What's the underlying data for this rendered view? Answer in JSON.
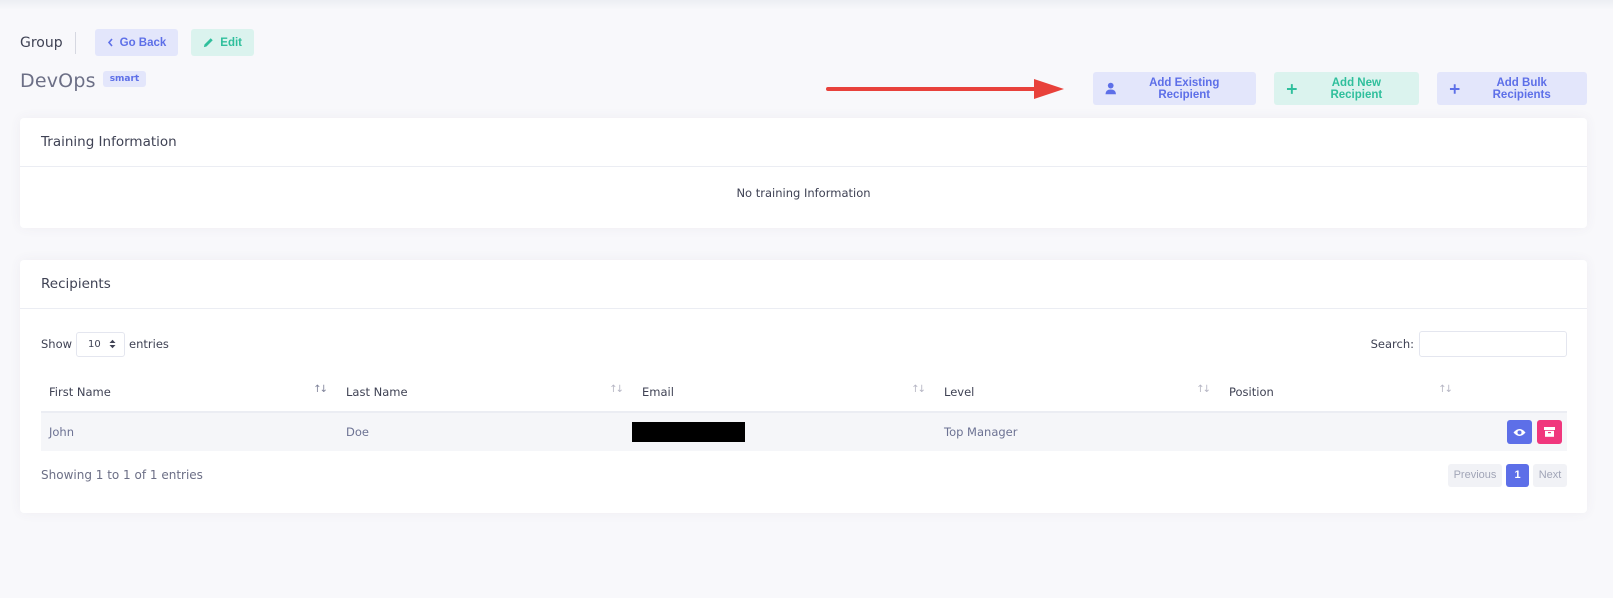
{
  "header": {
    "section_label": "Group",
    "go_back_label": "Go Back",
    "edit_label": "Edit"
  },
  "group": {
    "name": "DevOps",
    "badge": "smart"
  },
  "actions": {
    "add_existing": "Add Existing Recipient",
    "add_new": "Add New Recipient",
    "add_bulk": "Add Bulk Recipients"
  },
  "training": {
    "title": "Training Information",
    "empty_text": "No training Information"
  },
  "recipients": {
    "title": "Recipients",
    "show_label": "Show",
    "entries_label": "entries",
    "page_size": "10",
    "search_label": "Search:",
    "search_value": "",
    "columns": [
      "First Name",
      "Last Name",
      "Email",
      "Level",
      "Position"
    ],
    "rows": [
      {
        "first_name": "John",
        "last_name": "Doe",
        "email": "",
        "level": "Top Manager",
        "position": ""
      }
    ],
    "info": "Showing 1 to 1 of 1 entries",
    "pagination": {
      "previous": "Previous",
      "current": "1",
      "next": "Next"
    }
  },
  "colors": {
    "primary": "#5d6fe8",
    "success": "#2fbf9c",
    "danger": "#f0377d",
    "annotation_arrow": "#e8413b"
  },
  "icons": {
    "go_back": "chevron-left-icon",
    "edit": "pencil-icon",
    "add_existing": "user-icon",
    "add_new": "plus-icon",
    "add_bulk": "plus-icon",
    "view": "eye-icon",
    "archive": "archive-icon"
  }
}
